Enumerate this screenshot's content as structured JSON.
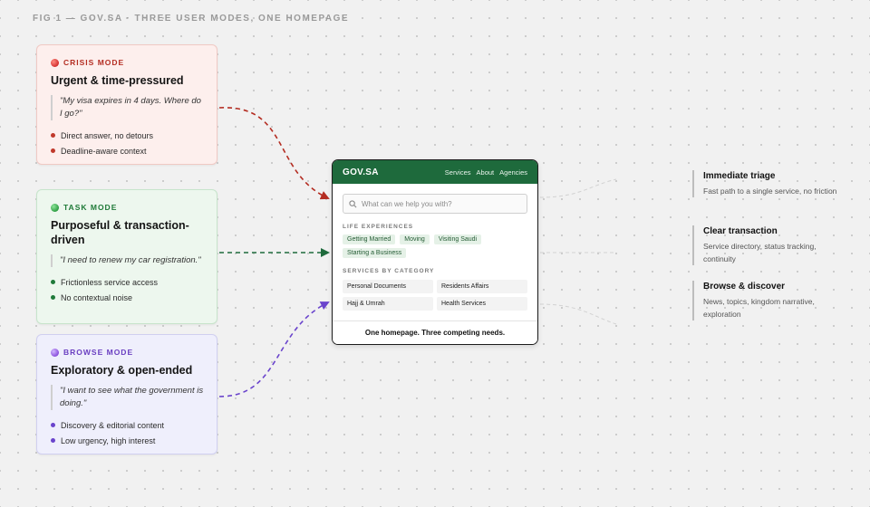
{
  "figure_label": "FIG 1 — GOV.SA · THREE USER MODES, ONE HOMEPAGE",
  "modes": [
    {
      "label": "CRISIS MODE",
      "title": "Urgent & time-pressured",
      "quote": "\"My visa expires in 4 days. Where do I go?\"",
      "bullets": [
        "Direct answer, no detours",
        "Deadline-aware context"
      ],
      "color": "#b42d22"
    },
    {
      "label": "TASK MODE",
      "title": "Purposeful & transaction-driven",
      "quote": "\"I need to renew my car registration.\"",
      "bullets": [
        "Frictionless service access",
        "No contextual noise"
      ],
      "color": "#1e7a37"
    },
    {
      "label": "BROWSE MODE",
      "title": "Exploratory & open-ended",
      "quote": "\"I want to see what the government is doing.\"",
      "bullets": [
        "Discovery & editorial content",
        "Low urgency, high interest"
      ],
      "color": "#6a3fc1"
    }
  ],
  "homepage": {
    "logo": "GOV.SA",
    "nav": [
      "Services",
      "About",
      "Agencies"
    ],
    "search_placeholder": "What can we help you with?",
    "life_experiences_label": "LIFE EXPERIENCES",
    "life_experiences": [
      "Getting Married",
      "Moving",
      "Visiting Saudi",
      "Starting a Business"
    ],
    "services_label": "SERVICES BY CATEGORY",
    "services": [
      "Personal Documents",
      "Residents Affairs",
      "Hajj & Umrah",
      "Health Services"
    ],
    "footer": "One homepage. Three competing needs.",
    "header_color": "#1e6a3c"
  },
  "outcomes": [
    {
      "title": "Immediate triage",
      "desc": "Fast path to a single service, no friction"
    },
    {
      "title": "Clear transaction",
      "desc": "Service directory, status tracking, continuity"
    },
    {
      "title": "Browse & discover",
      "desc": "News, topics, kingdom narrative, exploration"
    }
  ]
}
